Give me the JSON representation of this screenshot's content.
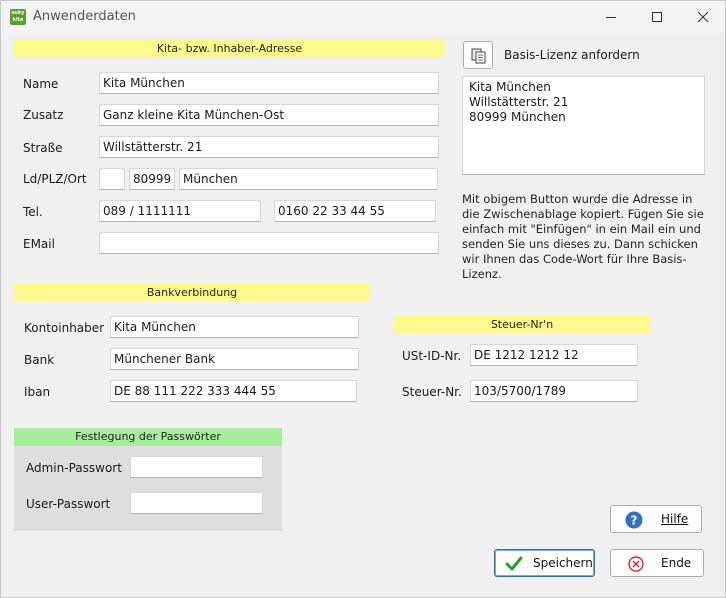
{
  "window": {
    "title": "Anwenderdaten",
    "app_icon_text": "suky\nkita"
  },
  "address": {
    "header": "Kita-  bzw. Inhaber-Adresse",
    "name_label": "Name",
    "name_value": "Kita München",
    "zusatz_label": "Zusatz",
    "zusatz_value": "Ganz kleine Kita München-Ost",
    "strasse_label": "Straße",
    "strasse_value": "Willstätterstr. 21",
    "ldplzort_label": "Ld/PLZ/Ort",
    "land_value": "",
    "plz_value": "80999",
    "ort_value": "München",
    "tel_label": "Tel.",
    "tel1_value": "089 / 1111111",
    "tel2_value": "0160 22 33 44 55",
    "email_label": "EMail",
    "email_value": ""
  },
  "license": {
    "button_label": "Basis-Lizenz anfordern",
    "memo_lines": [
      "Kita München",
      "Willstätterstr. 21",
      "80999 München"
    ],
    "info_text": "Mit obigem Button wurde die Adresse in die Zwischenablage kopiert. Fügen Sie sie einfach mit \"Einfügen\" in ein Mail ein und senden Sie uns dieses zu. Dann schicken wir Ihnen das Code-Wort für Ihre Basis-Lizenz."
  },
  "bank": {
    "header": "Bankverbindung",
    "kontoinhaber_label": "Kontoinhaber",
    "kontoinhaber_value": "Kita München",
    "bank_label": "Bank",
    "bank_value": "Münchener Bank",
    "iban_label": "Iban",
    "iban_value": "DE 88 111 222 333 444 55"
  },
  "tax": {
    "header": "Steuer-Nr'n",
    "ust_label": "USt-ID-Nr.",
    "ust_value": "DE 1212 1212 12",
    "steuer_label": "Steuer-Nr.",
    "steuer_value": "103/5700/1789"
  },
  "passwords": {
    "header": "Festlegung der Passwörter",
    "admin_label": "Admin-Passwort",
    "admin_value": "",
    "user_label": "User-Passwort",
    "user_value": ""
  },
  "buttons": {
    "help": "Hilfe",
    "save": "Speichern",
    "end": "Ende"
  },
  "colors": {
    "yellow_header": "#fffa8c",
    "green_header": "#a6ee9c",
    "save_check": "#2e9a2e",
    "end_x": "#d62b2b",
    "help_icon": "#2f6fc4"
  }
}
